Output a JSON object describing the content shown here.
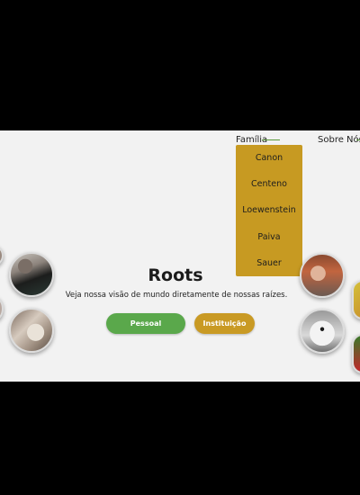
{
  "nav": {
    "family_label": "Família",
    "about_label": "Sobre Nós",
    "family_dropdown": [
      "Canon",
      "Centeno",
      "Loewenstein",
      "Paiva",
      "Sauer"
    ]
  },
  "hero": {
    "title": "Roots",
    "subtitle": "Veja nossa visão de mundo diretamente de nossas raízes.",
    "personal_button": "Pessoal",
    "institution_button": "Instituição"
  },
  "colors": {
    "green": "#5aa84b",
    "gold": "#c99a24",
    "background": "#f2f2f2"
  }
}
